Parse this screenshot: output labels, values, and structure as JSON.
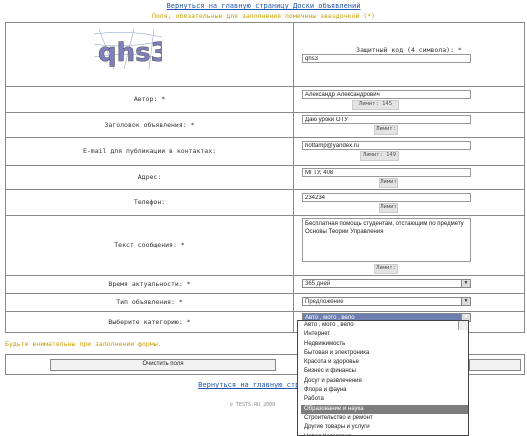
{
  "top_link": "Вернуться на главную страницу Доски объявлений",
  "required_note": "Поля, обязательные для заполнения помечены звездочкой (*)",
  "captcha": {
    "text": "qhs3",
    "label": "Защитный код (4 символа): *",
    "value": "qhs3"
  },
  "fields": {
    "author": {
      "label": "Автор: *",
      "value": "Александр Александрович",
      "counter": "Лимит: 145"
    },
    "title": {
      "label": "Заголовок объявления: *",
      "value": "Даю уроки ОТУ",
      "counter": "Лимит:"
    },
    "email": {
      "label": "E-mail для публикации в контактах:",
      "value": "hottamp@yandex.ru",
      "counter": "Лимит: 149"
    },
    "address": {
      "label": "Адрес:",
      "value": "МГТУ, 408",
      "counter": "Лимит"
    },
    "phone": {
      "label": "Телефон:",
      "value": "234234",
      "counter": "Лимит"
    },
    "message": {
      "label": "Текст сообщения: *",
      "value": "Бесплатная помощь студентам, отстающим по предмету Основы Теории Управления",
      "counter": "Лимит:"
    },
    "period": {
      "label": "Время актуальности: *",
      "value": "365 дней"
    },
    "type": {
      "label": "Тип объявления: *",
      "value": "Предложение"
    },
    "category": {
      "label": "Выберите категорию: *",
      "value": "Авто , мото , вело"
    }
  },
  "category_options": [
    "Авто , мото , вело",
    "Интернет",
    "Недвижимость",
    "Бытовая и электроника",
    "Красота и здоровье",
    "Бизнес и финансы",
    "Досуг и развлечения",
    "Флора и фауна",
    "Работа",
    "Образование и наука",
    "Строительство и ремонт",
    "Другие товары и услуги",
    "Новая Категория"
  ],
  "highlighted_option_index": 9,
  "fill_notice": "Будьте внимательны при заполнении формы.",
  "clear_button": "Очистить поля",
  "bottom_link": "Вернуться на главную страницу Д",
  "footer": "© TESTS.RU 2009"
}
